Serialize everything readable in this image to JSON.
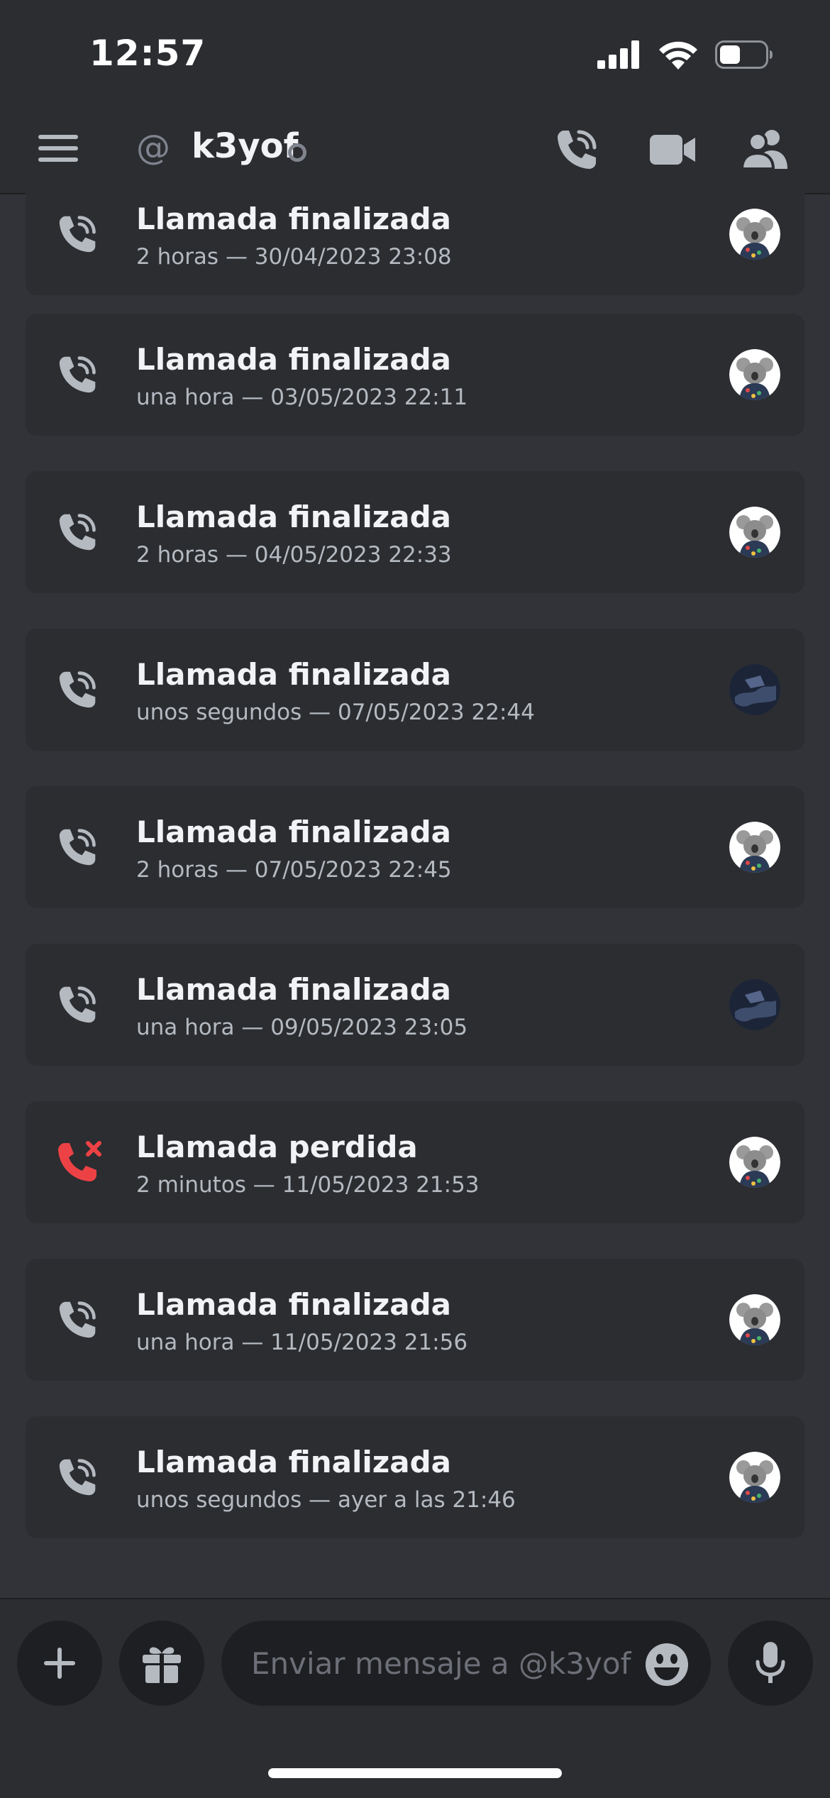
{
  "status_bar": {
    "time": "12:57"
  },
  "header": {
    "at_symbol": "@",
    "username": "k3yof"
  },
  "calls": [
    {
      "title": "Llamada finalizada",
      "subtitle": "2 horas — 30/04/2023 23:08",
      "status": "ended",
      "avatar": "koala"
    },
    {
      "title": "Llamada finalizada",
      "subtitle": "una hora — 03/05/2023 22:11",
      "status": "ended",
      "avatar": "koala"
    },
    {
      "title": "Llamada finalizada",
      "subtitle": "2 horas — 04/05/2023 22:33",
      "status": "ended",
      "avatar": "koala"
    },
    {
      "title": "Llamada finalizada",
      "subtitle": "unos segundos — 07/05/2023 22:44",
      "status": "ended",
      "avatar": "dark"
    },
    {
      "title": "Llamada finalizada",
      "subtitle": "2 horas — 07/05/2023 22:45",
      "status": "ended",
      "avatar": "koala"
    },
    {
      "title": "Llamada finalizada",
      "subtitle": "una hora — 09/05/2023 23:05",
      "status": "ended",
      "avatar": "dark"
    },
    {
      "title": "Llamada perdida",
      "subtitle": "2 minutos — 11/05/2023 21:53",
      "status": "missed",
      "avatar": "koala"
    },
    {
      "title": "Llamada finalizada",
      "subtitle": "una hora — 11/05/2023 21:56",
      "status": "ended",
      "avatar": "koala"
    },
    {
      "title": "Llamada finalizada",
      "subtitle": "unos segundos — ayer a las 21:46",
      "status": "ended",
      "avatar": "koala"
    }
  ],
  "composer": {
    "placeholder": "Enviar mensaje a @k3yof"
  },
  "colors": {
    "background": "#313338",
    "card": "#2b2d31",
    "missed": "#ed4245",
    "muted": "#b5bac1"
  },
  "icons": [
    "menu-icon",
    "phone-call-icon",
    "video-camera-icon",
    "members-icon",
    "plus-icon",
    "gift-icon",
    "emoji-icon",
    "microphone-icon"
  ]
}
